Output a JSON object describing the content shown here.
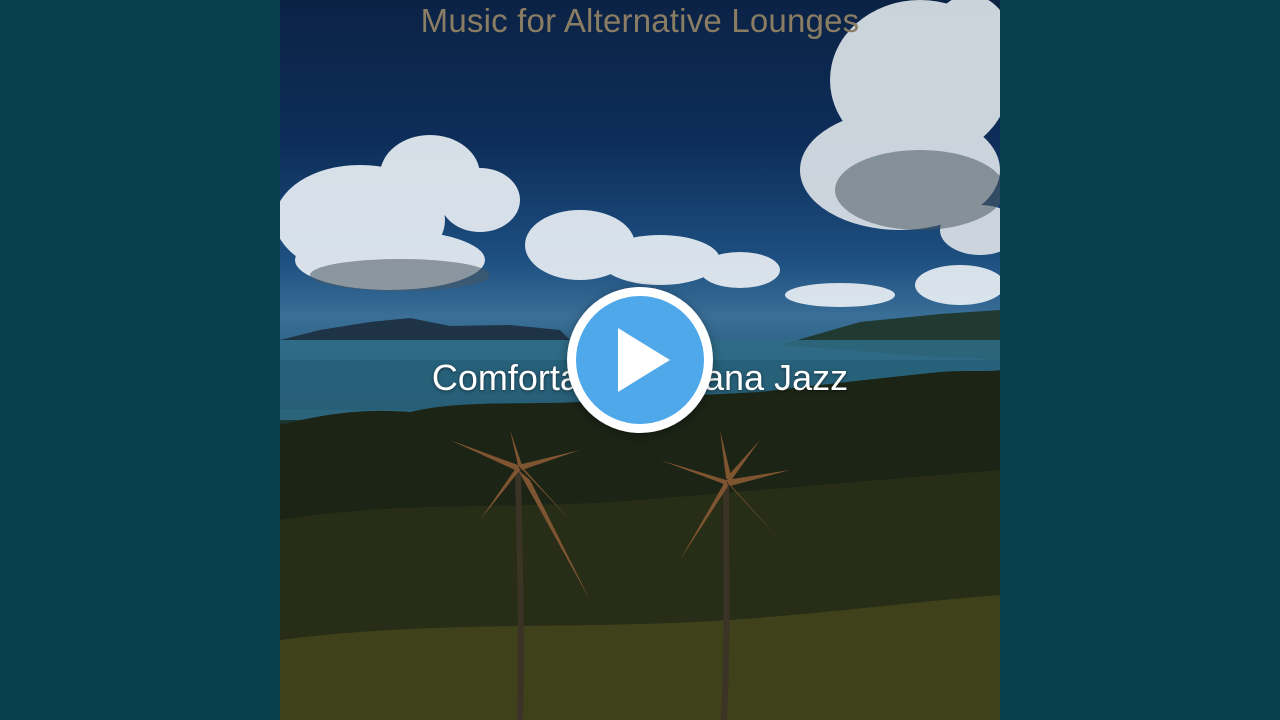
{
  "video": {
    "album_text": "Music for Alternative Lounges",
    "track_text": "Comfortable Cabana Jazz",
    "play_icon": "play-icon",
    "background_color": "#08404f",
    "play_color": "#4fa8ea"
  }
}
